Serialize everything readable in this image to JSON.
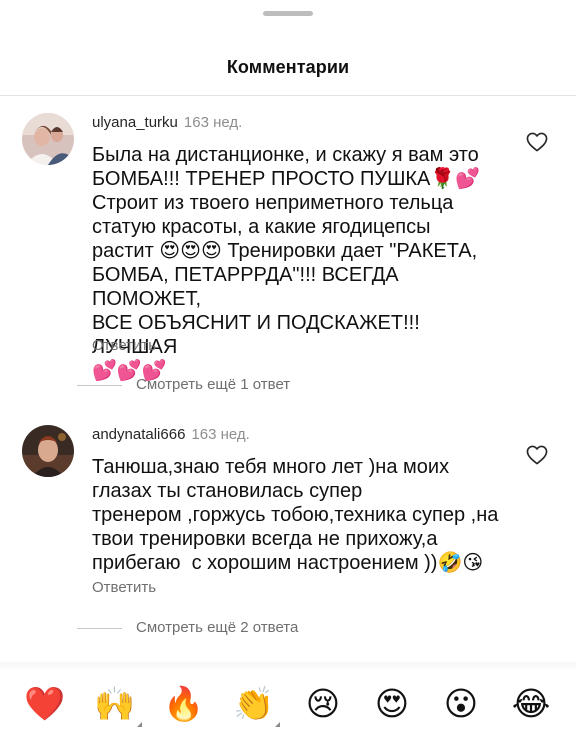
{
  "header": {
    "title": "Комментарии"
  },
  "comments": [
    {
      "username": "ulyana_turku",
      "time": "163 нед.",
      "text": "Была на дистанционке, и скажу я вам это\nБОМБА!!! ТРЕНЕР ПРОСТО ПУШКА🌹💕\nСтроит из твоего неприметного тельца\nстатую красоты, а какие ягодицепсы\nрастит 😍😍😍 Тренировки дает \"РАКЕТА,\nБОМБА, ПЕТАРРРДА\"!!! ВСЕГДА ПОМОЖЕТ,\nВСЕ ОБЪЯСНИТ И ПОДСКАЖЕТ!!! ЛУЧШАЯ\n💕💕💕",
      "reply_label": "Ответить",
      "more_replies": "Смотреть ещё 1 ответ"
    },
    {
      "username": "andynatali666",
      "time": "163 нед.",
      "text": "Танюша,знаю тебя много лет )на моих\nглазах ты становилась супер\nтренером ,горжусь тобою,техника супер ,на\nтвои тренировки всегда не прихожу,а\nприбегаю  с хорошим настроением ))🤣😘",
      "reply_label": "Ответить",
      "more_replies": "Смотреть ещё 2 ответа"
    }
  ],
  "emoji_bar": {
    "items": [
      {
        "name": "red-heart",
        "glyph": "❤️"
      },
      {
        "name": "raising-hands",
        "glyph": "🙌"
      },
      {
        "name": "fire",
        "glyph": "🔥"
      },
      {
        "name": "clapping-hands",
        "glyph": "👏"
      },
      {
        "name": "crying-face",
        "glyph": "😢"
      },
      {
        "name": "heart-eyes",
        "glyph": "😍"
      },
      {
        "name": "astonished-face",
        "glyph": "😮"
      },
      {
        "name": "tears-of-joy",
        "glyph": "😂"
      }
    ]
  },
  "colors": {
    "meta_gray": "#8e8e8e",
    "reply_gray": "#6f6f6f",
    "text": "#111111"
  }
}
